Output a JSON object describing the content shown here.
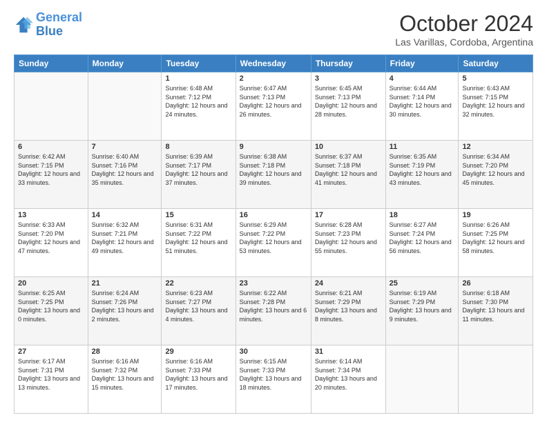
{
  "header": {
    "logo_line1": "General",
    "logo_line2": "Blue",
    "month": "October 2024",
    "location": "Las Varillas, Cordoba, Argentina"
  },
  "days_of_week": [
    "Sunday",
    "Monday",
    "Tuesday",
    "Wednesday",
    "Thursday",
    "Friday",
    "Saturday"
  ],
  "weeks": [
    [
      {
        "day": "",
        "info": ""
      },
      {
        "day": "",
        "info": ""
      },
      {
        "day": "1",
        "info": "Sunrise: 6:48 AM\nSunset: 7:12 PM\nDaylight: 12 hours and 24 minutes."
      },
      {
        "day": "2",
        "info": "Sunrise: 6:47 AM\nSunset: 7:13 PM\nDaylight: 12 hours and 26 minutes."
      },
      {
        "day": "3",
        "info": "Sunrise: 6:45 AM\nSunset: 7:13 PM\nDaylight: 12 hours and 28 minutes."
      },
      {
        "day": "4",
        "info": "Sunrise: 6:44 AM\nSunset: 7:14 PM\nDaylight: 12 hours and 30 minutes."
      },
      {
        "day": "5",
        "info": "Sunrise: 6:43 AM\nSunset: 7:15 PM\nDaylight: 12 hours and 32 minutes."
      }
    ],
    [
      {
        "day": "6",
        "info": "Sunrise: 6:42 AM\nSunset: 7:15 PM\nDaylight: 12 hours and 33 minutes."
      },
      {
        "day": "7",
        "info": "Sunrise: 6:40 AM\nSunset: 7:16 PM\nDaylight: 12 hours and 35 minutes."
      },
      {
        "day": "8",
        "info": "Sunrise: 6:39 AM\nSunset: 7:17 PM\nDaylight: 12 hours and 37 minutes."
      },
      {
        "day": "9",
        "info": "Sunrise: 6:38 AM\nSunset: 7:18 PM\nDaylight: 12 hours and 39 minutes."
      },
      {
        "day": "10",
        "info": "Sunrise: 6:37 AM\nSunset: 7:18 PM\nDaylight: 12 hours and 41 minutes."
      },
      {
        "day": "11",
        "info": "Sunrise: 6:35 AM\nSunset: 7:19 PM\nDaylight: 12 hours and 43 minutes."
      },
      {
        "day": "12",
        "info": "Sunrise: 6:34 AM\nSunset: 7:20 PM\nDaylight: 12 hours and 45 minutes."
      }
    ],
    [
      {
        "day": "13",
        "info": "Sunrise: 6:33 AM\nSunset: 7:20 PM\nDaylight: 12 hours and 47 minutes."
      },
      {
        "day": "14",
        "info": "Sunrise: 6:32 AM\nSunset: 7:21 PM\nDaylight: 12 hours and 49 minutes."
      },
      {
        "day": "15",
        "info": "Sunrise: 6:31 AM\nSunset: 7:22 PM\nDaylight: 12 hours and 51 minutes."
      },
      {
        "day": "16",
        "info": "Sunrise: 6:29 AM\nSunset: 7:22 PM\nDaylight: 12 hours and 53 minutes."
      },
      {
        "day": "17",
        "info": "Sunrise: 6:28 AM\nSunset: 7:23 PM\nDaylight: 12 hours and 55 minutes."
      },
      {
        "day": "18",
        "info": "Sunrise: 6:27 AM\nSunset: 7:24 PM\nDaylight: 12 hours and 56 minutes."
      },
      {
        "day": "19",
        "info": "Sunrise: 6:26 AM\nSunset: 7:25 PM\nDaylight: 12 hours and 58 minutes."
      }
    ],
    [
      {
        "day": "20",
        "info": "Sunrise: 6:25 AM\nSunset: 7:25 PM\nDaylight: 13 hours and 0 minutes."
      },
      {
        "day": "21",
        "info": "Sunrise: 6:24 AM\nSunset: 7:26 PM\nDaylight: 13 hours and 2 minutes."
      },
      {
        "day": "22",
        "info": "Sunrise: 6:23 AM\nSunset: 7:27 PM\nDaylight: 13 hours and 4 minutes."
      },
      {
        "day": "23",
        "info": "Sunrise: 6:22 AM\nSunset: 7:28 PM\nDaylight: 13 hours and 6 minutes."
      },
      {
        "day": "24",
        "info": "Sunrise: 6:21 AM\nSunset: 7:29 PM\nDaylight: 13 hours and 8 minutes."
      },
      {
        "day": "25",
        "info": "Sunrise: 6:19 AM\nSunset: 7:29 PM\nDaylight: 13 hours and 9 minutes."
      },
      {
        "day": "26",
        "info": "Sunrise: 6:18 AM\nSunset: 7:30 PM\nDaylight: 13 hours and 11 minutes."
      }
    ],
    [
      {
        "day": "27",
        "info": "Sunrise: 6:17 AM\nSunset: 7:31 PM\nDaylight: 13 hours and 13 minutes."
      },
      {
        "day": "28",
        "info": "Sunrise: 6:16 AM\nSunset: 7:32 PM\nDaylight: 13 hours and 15 minutes."
      },
      {
        "day": "29",
        "info": "Sunrise: 6:16 AM\nSunset: 7:33 PM\nDaylight: 13 hours and 17 minutes."
      },
      {
        "day": "30",
        "info": "Sunrise: 6:15 AM\nSunset: 7:33 PM\nDaylight: 13 hours and 18 minutes."
      },
      {
        "day": "31",
        "info": "Sunrise: 6:14 AM\nSunset: 7:34 PM\nDaylight: 13 hours and 20 minutes."
      },
      {
        "day": "",
        "info": ""
      },
      {
        "day": "",
        "info": ""
      }
    ]
  ]
}
